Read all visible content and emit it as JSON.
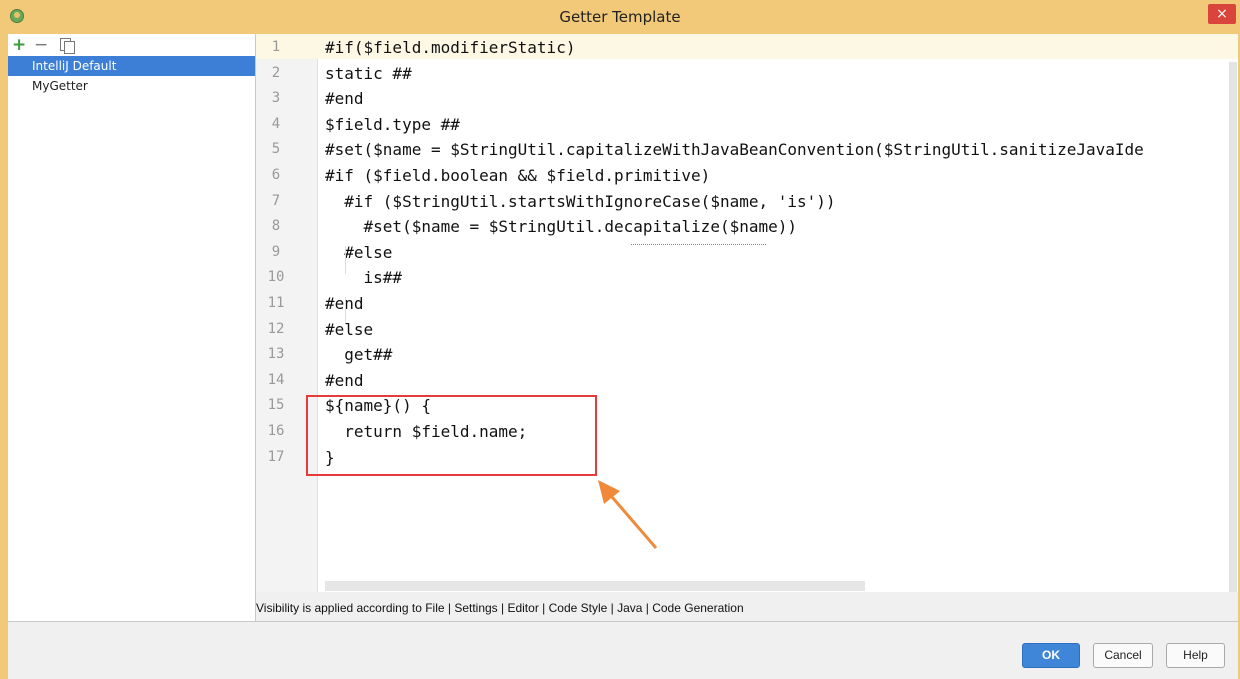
{
  "window": {
    "title": "Getter Template",
    "close_glyph": "×"
  },
  "toolbar": {
    "add_glyph": "+",
    "remove_glyph": "−"
  },
  "templates": [
    {
      "label": "IntelliJ Default",
      "selected": true
    },
    {
      "label": "MyGetter",
      "selected": false
    }
  ],
  "editor": {
    "lines": [
      {
        "num": "1",
        "text": "#if($field.modifierStatic)"
      },
      {
        "num": "2",
        "text": "static ##"
      },
      {
        "num": "3",
        "text": "#end"
      },
      {
        "num": "4",
        "text": "$field.type ##"
      },
      {
        "num": "5",
        "text": "#set($name = $StringUtil.capitalizeWithJavaBeanConvention($StringUtil.sanitizeJavaIde"
      },
      {
        "num": "6",
        "text": "#if ($field.boolean && $field.primitive)"
      },
      {
        "num": "7",
        "text": "  #if ($StringUtil.startsWithIgnoreCase($name, 'is'))"
      },
      {
        "num": "8",
        "text": "    #set($name = $StringUtil.decapitalize($name))"
      },
      {
        "num": "9",
        "text": "  #else"
      },
      {
        "num": "10",
        "text": "    is##"
      },
      {
        "num": "11",
        "text": "#end"
      },
      {
        "num": "12",
        "text": "#else"
      },
      {
        "num": "13",
        "text": "  get##"
      },
      {
        "num": "14",
        "text": "#end"
      },
      {
        "num": "15",
        "text": "${name}() {"
      },
      {
        "num": "16",
        "text": "  return $field.name;"
      },
      {
        "num": "17",
        "text": "}"
      }
    ]
  },
  "info": {
    "text": "Visibility is applied according to File | Settings | Editor | Code Style | Java | Code Generation"
  },
  "buttons": {
    "ok": "OK",
    "cancel": "Cancel",
    "help": "Help"
  },
  "colors": {
    "title_bar": "#f2c879",
    "selection": "#3d7fd6",
    "annotation": "#e53b3b",
    "arrow": "#f08a3a"
  }
}
